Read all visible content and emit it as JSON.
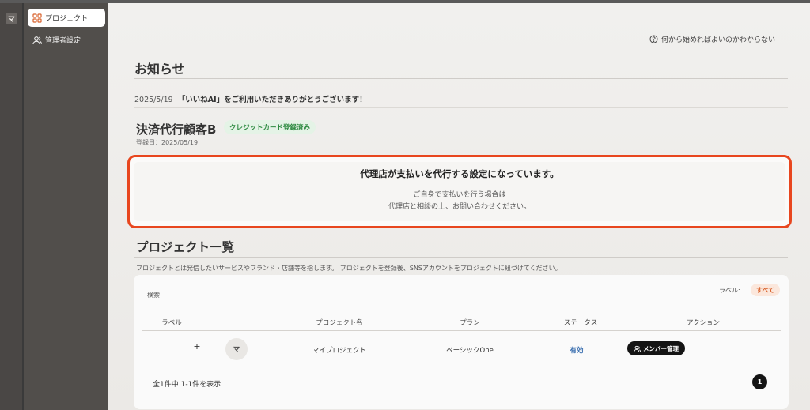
{
  "rail": {
    "logo_letter": "マ"
  },
  "sidebar": {
    "items": [
      {
        "label": "プロジェクト",
        "icon": "grid-icon",
        "active": true
      },
      {
        "label": "管理者設定",
        "icon": "user-icon",
        "active": false
      }
    ]
  },
  "header": {
    "help_text": "何から始めればよいのかわからない"
  },
  "news": {
    "title": "お知らせ",
    "items": [
      {
        "date": "2025/5/19",
        "text": "「いいねAI」をご利用いただきありがとうございます！"
      }
    ]
  },
  "customer": {
    "name": "決済代行顧客B",
    "badge": "クレジットカード登録済み",
    "registered": "登録日：2025/05/19"
  },
  "notice": {
    "title": "代理店が支払いを代行する設定になっています。",
    "line1": "ご自身で支払いを行う場合は",
    "line2": "代理店と相談の上、お問い合わせください。"
  },
  "projects": {
    "title": "プロジェクト一覧",
    "description": "プロジェクトとは発信したいサービスやブランド・店舗等を指します。 プロジェクトを登録後、SNSアカウントをプロジェクトに紐づけてください。",
    "search_placeholder": "検索",
    "label_filter": "ラベル:",
    "label_all": "すべて",
    "columns": [
      "ラベル",
      "プロジェクト名",
      "プラン",
      "ステータス",
      "アクション"
    ],
    "rows": [
      {
        "add_label": "+",
        "avatar": "マ",
        "name": "マイプロジェクト",
        "plan": "ベーシックOne",
        "status": "有効",
        "action": "メンバー管理"
      }
    ],
    "summary": "全1件中 1-1件を表示",
    "page": "1"
  },
  "colors": {
    "accent_border": "#e8461e",
    "badge_green": "#2e8b42",
    "status_blue": "#3a6fb0",
    "label_orange": "#d8612b"
  }
}
